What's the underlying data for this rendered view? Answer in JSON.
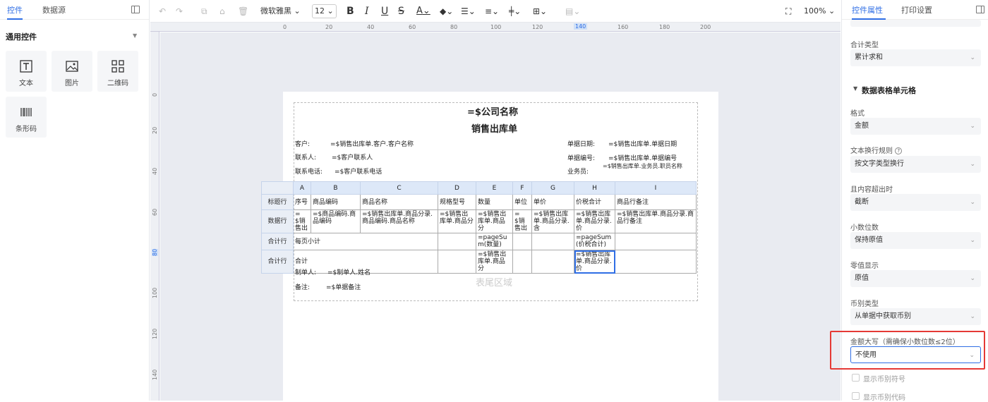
{
  "left_panel": {
    "tabs": [
      "控件",
      "数据源"
    ],
    "section_title": "通用控件",
    "controls": [
      "文本",
      "图片",
      "二维码",
      "条形码"
    ]
  },
  "toolbar": {
    "font_family": "微软雅黑",
    "font_size": "12",
    "zoom": "100%",
    "buttons": [
      "B",
      "I",
      "U",
      "S",
      "A"
    ]
  },
  "ruler": {
    "h_labels": [
      "0",
      "20",
      "40",
      "60",
      "80",
      "100",
      "120",
      "140",
      "160",
      "180",
      "200"
    ],
    "v_labels": [
      "0",
      "20",
      "40",
      "60",
      "80",
      "100",
      "120",
      "140"
    ]
  },
  "report": {
    "company": "=$公司名称",
    "title": "销售出库单",
    "fields": {
      "customer_label": "客户:",
      "customer_value": "=$销售出库单.客户.客户名称",
      "contact_label": "联系人:",
      "contact_value": "=$客户联系人",
      "phone_label": "联系电话:",
      "phone_value": "=$客户联系电话",
      "date_label": "单据日期:",
      "date_value": "=$销售出库单.单据日期",
      "number_label": "单据编号:",
      "number_value": "=$销售出库单.单据编号",
      "staff_label": "业务员:",
      "staff_value": "=$销售出库单.业务员.职员名称"
    },
    "columns": [
      "A",
      "B",
      "C",
      "D",
      "E",
      "F",
      "G",
      "H",
      "I"
    ],
    "rows": [
      {
        "label": "标题行",
        "cells": [
          "序号",
          "商品编码",
          "商品名称",
          "规格型号",
          "数量",
          "单位",
          "单价",
          "价税合计",
          "商品行备注"
        ]
      },
      {
        "label": "数据行",
        "cells": [
          "=$销售出",
          "=$商品编码.商品编码",
          "=$销售出库单.商品分录.商品编码.商品名称",
          "=$销售出库单.商品分",
          "=$销售出库单.商品分",
          "=$销售出",
          "=$销售出库单.商品分录.含",
          "=$销售出库单.商品分录.价",
          "=$销售出库单.商品分录.商品行备注"
        ]
      },
      {
        "label": "合计行",
        "cells": [
          "每页小计",
          "",
          "",
          "",
          "=pageSum(数量)",
          "",
          "",
          "=pageSum(价税合计)",
          ""
        ]
      },
      {
        "label": "合计行",
        "cells": [
          "合计",
          "",
          "",
          "",
          "=$销售出库单.商品分",
          "",
          "",
          "=$销售出库单.商品分录.价",
          ""
        ]
      }
    ],
    "footer": {
      "maker_label": "制单人:",
      "maker_value": "=$制单人.姓名",
      "remark_label": "备注:",
      "remark_value": "=$单据备注",
      "watermark": "表尾区域"
    }
  },
  "right_panel": {
    "tabs": [
      "控件属性",
      "打印设置"
    ],
    "sum_type_label": "合计类型",
    "sum_type_value": "累计求和",
    "section_title": "数据表格单元格",
    "format_label": "格式",
    "format_value": "金额",
    "wrap_label": "文本换行规则",
    "wrap_value": "按文字类型换行",
    "overflow_label": "且内容超出时",
    "overflow_value": "截断",
    "decimal_label": "小数位数",
    "decimal_value": "保持原值",
    "zero_label": "零值显示",
    "zero_value": "原值",
    "currency_label": "币别类型",
    "currency_value": "从单据中获取币别",
    "amount_upper_label": "金额大写（需确保小数位数≤2位）",
    "amount_upper_value": "不使用",
    "show_symbol": "显示币别符号",
    "show_code": "显示币别代码"
  },
  "colors": {
    "accent": "#2f6ee5",
    "highlight": "#e53935"
  }
}
